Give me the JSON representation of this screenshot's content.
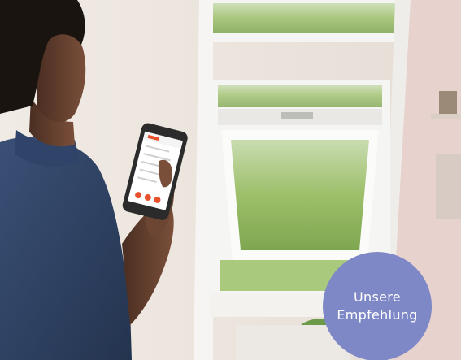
{
  "image": {
    "description_colors": {
      "wall": "#ece4dc",
      "window_frame": "#f5f5f3",
      "foliage": "#8fb35a",
      "shirt": "#2c3f63",
      "phone": "#2b2b2b",
      "accent": "#e8502b"
    }
  },
  "badge": {
    "line1": "Unsere",
    "line2": "Empfehlung",
    "color": "#7f88c6"
  }
}
